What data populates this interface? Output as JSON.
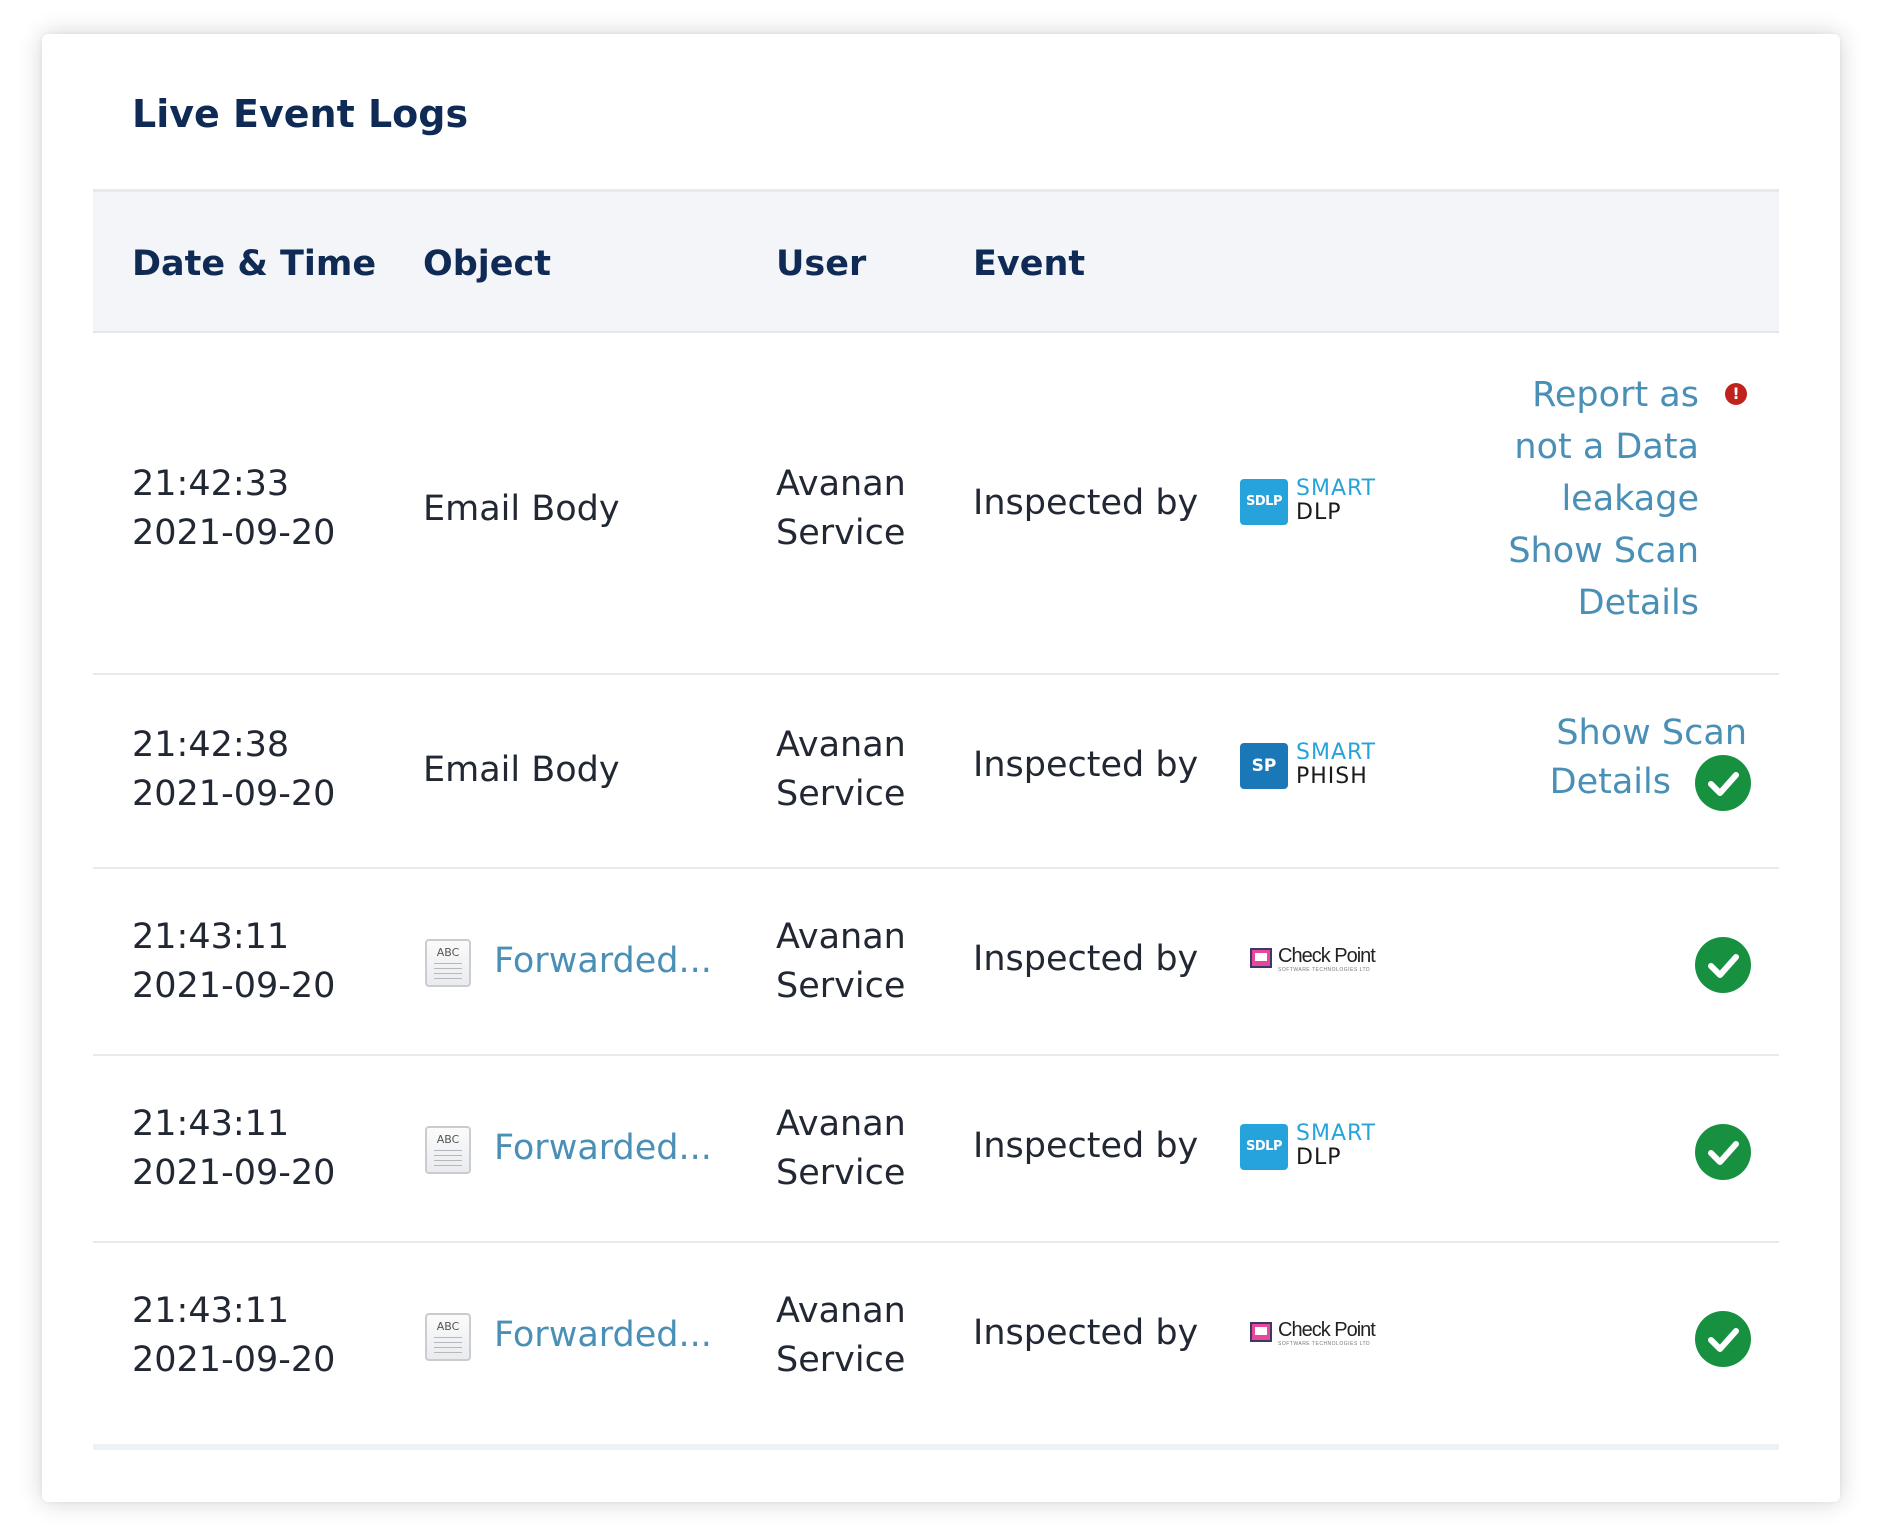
{
  "title": "Live Event Logs",
  "columns": {
    "date_time": "Date & Time",
    "object": "Object",
    "user": "User",
    "event": "Event"
  },
  "rows": [
    {
      "time": "21:42:33",
      "date": "2021-09-20",
      "object": "Email Body",
      "object_is_link": false,
      "user_line1": "Avanan",
      "user_line2": "Service",
      "event_text": "Inspected by",
      "logo": "smart-dlp",
      "status": "alert",
      "actions": [
        "Report as",
        "not a Data",
        "leakage",
        "Show Scan",
        "Details"
      ]
    },
    {
      "time": "21:42:38",
      "date": "2021-09-20",
      "object": "Email Body",
      "object_is_link": false,
      "user_line1": "Avanan",
      "user_line2": "Service",
      "event_text": "Inspected by",
      "logo": "smart-phish",
      "status": "ok",
      "actions": [
        "Show Scan",
        "Details"
      ]
    },
    {
      "time": "21:43:11",
      "date": "2021-09-20",
      "object": "Forwarded...",
      "object_is_link": true,
      "user_line1": "Avanan",
      "user_line2": "Service",
      "event_text": "Inspected by",
      "logo": "check-point",
      "status": "ok",
      "actions": []
    },
    {
      "time": "21:43:11",
      "date": "2021-09-20",
      "object": "Forwarded...",
      "object_is_link": true,
      "user_line1": "Avanan",
      "user_line2": "Service",
      "event_text": "Inspected by",
      "logo": "smart-dlp",
      "status": "ok",
      "actions": []
    },
    {
      "time": "21:43:11",
      "date": "2021-09-20",
      "object": "Forwarded...",
      "object_is_link": true,
      "user_line1": "Avanan",
      "user_line2": "Service",
      "event_text": "Inspected by",
      "logo": "check-point",
      "status": "ok",
      "actions": []
    }
  ],
  "logos": {
    "smart_dlp": {
      "badge": "SDLP",
      "top": "SMART",
      "bottom": "DLP"
    },
    "smart_phish": {
      "badge": "SP",
      "top": "SMART",
      "bottom": "PHISH"
    },
    "check_point": {
      "name": "Check Point",
      "sub": "SOFTWARE TECHNOLOGIES LTD"
    }
  },
  "file_icon_label": "ABC",
  "alert_glyph": "!",
  "colors": {
    "title": "#0f2b55",
    "link": "#4a8fb6",
    "success": "#17913f",
    "alert": "#c0221e",
    "header_bg": "#f3f5f8",
    "dlp_blue": "#27a3dc",
    "phish_blue": "#1b78b8"
  },
  "icons": {
    "status_ok": "check-circle-icon",
    "status_alert": "alert-circle-icon",
    "object_file": "text-file-icon"
  }
}
